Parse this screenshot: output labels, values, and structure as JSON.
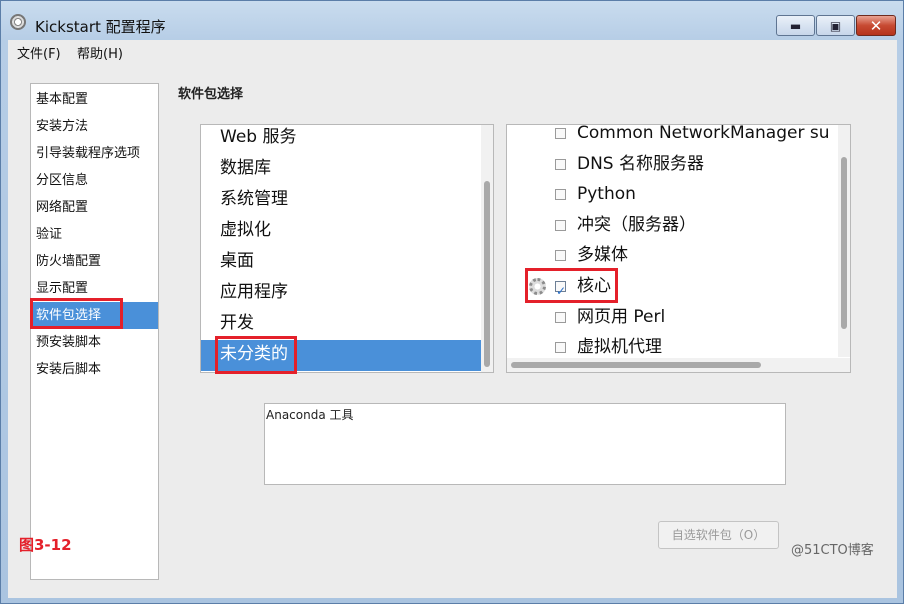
{
  "window": {
    "title": "Kickstart 配置程序",
    "minimize_glyph": "▬",
    "maximize_glyph": "▣",
    "close_glyph": "✕",
    "app_icon": "gear-icon"
  },
  "menubar": {
    "file": "文件(F)",
    "help": "帮助(H)"
  },
  "nav": {
    "items": [
      {
        "label": "基本配置"
      },
      {
        "label": "安装方法"
      },
      {
        "label": "引导装载程序选项"
      },
      {
        "label": "分区信息"
      },
      {
        "label": "网络配置"
      },
      {
        "label": "验证"
      },
      {
        "label": "防火墙配置"
      },
      {
        "label": "显示配置"
      },
      {
        "label": "软件包选择"
      },
      {
        "label": "预安装脚本"
      },
      {
        "label": "安装后脚本"
      }
    ],
    "selected_index": 8
  },
  "section_title": "软件包选择",
  "groups": {
    "items": [
      {
        "label": "Web 服务"
      },
      {
        "label": "数据库"
      },
      {
        "label": "系统管理"
      },
      {
        "label": "虚拟化"
      },
      {
        "label": "桌面"
      },
      {
        "label": "应用程序"
      },
      {
        "label": "开发"
      },
      {
        "label": "未分类的"
      }
    ],
    "selected_index": 7
  },
  "packages": {
    "items": [
      {
        "label": "Common NetworkManager su",
        "checked": false
      },
      {
        "label": "DNS 名称服务器",
        "checked": false
      },
      {
        "label": "Python",
        "checked": false
      },
      {
        "label": "冲突（服务器）",
        "checked": false
      },
      {
        "label": "多媒体",
        "checked": false
      },
      {
        "label": "核心",
        "checked": true
      },
      {
        "label": "网页用 Perl",
        "checked": false
      },
      {
        "label": "虚拟机代理",
        "checked": false
      }
    ]
  },
  "description": "Anaconda 工具",
  "optional_button": "自选软件包（O）",
  "figure_label": "图3-12",
  "watermark": "@51CTO博客",
  "colors": {
    "selection": "#4a90d9",
    "highlight_box": "#e4202a"
  }
}
